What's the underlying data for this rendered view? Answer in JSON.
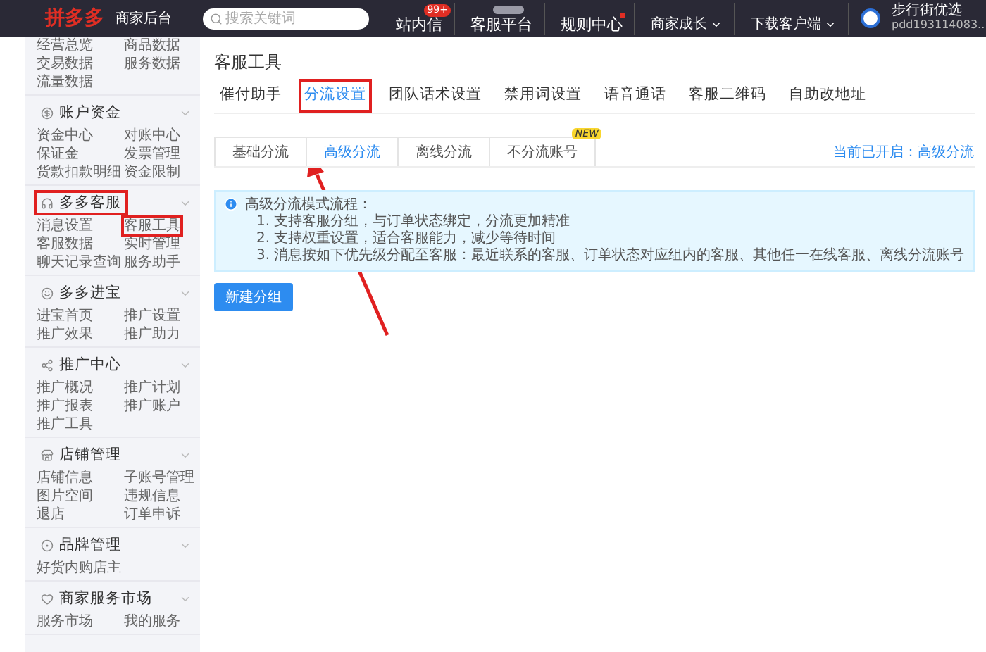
{
  "topbar": {
    "logo": "拼多多",
    "logo_sub": "商家后台",
    "search": {
      "placeholder": "搜索关键词"
    },
    "nav": [
      {
        "label": "站内信",
        "badge": "99+",
        "dot": false,
        "caret": false,
        "tag": false
      },
      {
        "label": "客服平台",
        "dot": false,
        "caret": false,
        "tag": true
      },
      {
        "label": "规则中心",
        "dot": true,
        "caret": false,
        "tag": false
      },
      {
        "label": "商家成长",
        "dot": false,
        "caret": true,
        "tag": false
      },
      {
        "label": "下载客户端",
        "dot": false,
        "caret": true,
        "tag": false
      }
    ],
    "user": {
      "name": "步行街优选",
      "account": "pdd193114083..."
    }
  },
  "sidebar": {
    "sections": [
      {
        "items": [
          {
            "label": "经营总览",
            "highlighted": false
          },
          {
            "label": "商品数据",
            "highlighted": false
          },
          {
            "label": "交易数据",
            "highlighted": false
          },
          {
            "label": "服务数据",
            "highlighted": false
          },
          {
            "label": "流量数据",
            "highlighted": false
          }
        ]
      },
      {
        "title": "账户资金",
        "highlighted": false,
        "items": [
          {
            "label": "资金中心",
            "highlighted": false
          },
          {
            "label": "对账中心",
            "highlighted": false
          },
          {
            "label": "保证金",
            "highlighted": false
          },
          {
            "label": "发票管理",
            "highlighted": false
          },
          {
            "label": "货款扣款明细",
            "highlighted": false
          },
          {
            "label": "资金限制",
            "highlighted": false
          }
        ]
      },
      {
        "title": "多多客服",
        "highlighted": true,
        "items": [
          {
            "label": "消息设置",
            "highlighted": false
          },
          {
            "label": "客服工具",
            "highlighted": true
          },
          {
            "label": "客服数据",
            "highlighted": false
          },
          {
            "label": "实时管理",
            "highlighted": false
          },
          {
            "label": "聊天记录查询",
            "highlighted": false
          },
          {
            "label": "服务助手",
            "highlighted": false
          }
        ]
      },
      {
        "title": "多多进宝",
        "highlighted": false,
        "items": [
          {
            "label": "进宝首页",
            "highlighted": false
          },
          {
            "label": "推广设置",
            "highlighted": false
          },
          {
            "label": "推广效果",
            "highlighted": false
          },
          {
            "label": "推广助力",
            "highlighted": false
          }
        ]
      },
      {
        "title": "推广中心",
        "highlighted": false,
        "items": [
          {
            "label": "推广概况",
            "highlighted": false
          },
          {
            "label": "推广计划",
            "highlighted": false
          },
          {
            "label": "推广报表",
            "highlighted": false
          },
          {
            "label": "推广账户",
            "highlighted": false
          },
          {
            "label": "推广工具",
            "highlighted": false
          }
        ]
      },
      {
        "title": "店铺管理",
        "highlighted": false,
        "items": [
          {
            "label": "店铺信息",
            "highlighted": false
          },
          {
            "label": "子账号管理",
            "highlighted": false
          },
          {
            "label": "图片空间",
            "highlighted": false
          },
          {
            "label": "违规信息",
            "highlighted": false
          },
          {
            "label": "退店",
            "highlighted": false
          },
          {
            "label": "订单申诉",
            "highlighted": false
          }
        ]
      },
      {
        "title": "品牌管理",
        "highlighted": false,
        "items": [
          {
            "label": "好货内购店主",
            "highlighted": false
          }
        ]
      },
      {
        "title": "商家服务市场",
        "highlighted": false,
        "items": [
          {
            "label": "服务市场",
            "highlighted": false
          },
          {
            "label": "我的服务",
            "highlighted": false
          }
        ]
      }
    ]
  },
  "page": {
    "title": "客服工具",
    "tabs": [
      {
        "label": "催付助手",
        "selected": false,
        "highlighted": false
      },
      {
        "label": "分流设置",
        "selected": true,
        "highlighted": true
      },
      {
        "label": "团队话术设置",
        "selected": false,
        "highlighted": false
      },
      {
        "label": "禁用词设置",
        "selected": false,
        "highlighted": false
      },
      {
        "label": "语音通话",
        "selected": false,
        "highlighted": false
      },
      {
        "label": "客服二维码",
        "selected": false,
        "highlighted": false
      },
      {
        "label": "自助改地址",
        "selected": false,
        "highlighted": false
      }
    ],
    "subtabs": [
      {
        "label": "基础分流",
        "selected": false
      },
      {
        "label": "高级分流",
        "selected": true
      },
      {
        "label": "离线分流",
        "selected": false
      },
      {
        "label": "不分流账号",
        "selected": false,
        "badge": "NEW"
      }
    ],
    "status": "当前已开启：高级分流",
    "info": {
      "title": "高级分流模式流程：",
      "lines": [
        "1. 支持客服分组，与订单状态绑定，分流更加精准",
        "2. 支持权重设置，适合客服能力，减少等待时间",
        "3. 消息按如下优先级分配至客服：最近联系的客服、订单状态对应组内的客服、其他任一在线客服、离线分流账号"
      ]
    },
    "button": "新建分组"
  }
}
